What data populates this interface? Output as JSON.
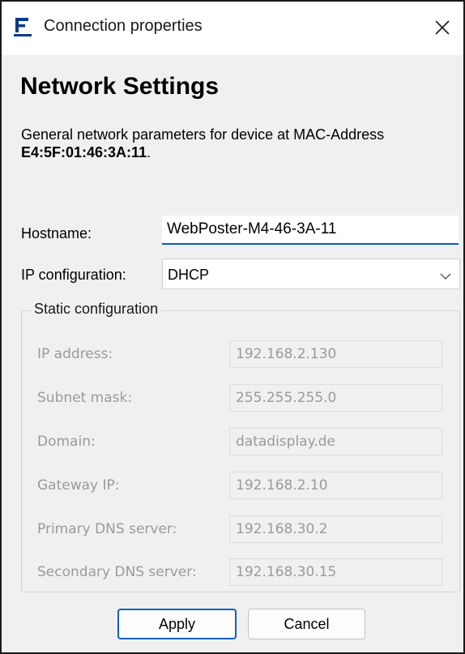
{
  "window": {
    "title": "Connection properties",
    "icon": "app-logo-f",
    "close_icon": "close-icon"
  },
  "heading": "Network Settings",
  "description": {
    "text": "General network parameters for device at MAC-Address",
    "mac": "E4:5F:01:46:3A:11",
    "suffix": "."
  },
  "hostname": {
    "label": "Hostname:",
    "value": "WebPoster-M4-46-3A-11"
  },
  "ip_configuration": {
    "label": "IP configuration:",
    "selected": "DHCP"
  },
  "static_configuration": {
    "title": "Static configuration",
    "fields": [
      {
        "label": "IP address:",
        "value": "192.168.2.130"
      },
      {
        "label": "Subnet mask:",
        "value": "255.255.255.0"
      },
      {
        "label": "Domain:",
        "value": "datadisplay.de"
      },
      {
        "label": "Gateway IP:",
        "value": "192.168.2.10"
      },
      {
        "label": "Primary DNS server:",
        "value": "192.168.30.2"
      },
      {
        "label": "Secondary DNS server:",
        "value": "192.168.30.15"
      }
    ]
  },
  "buttons": {
    "apply": "Apply",
    "cancel": "Cancel"
  },
  "colors": {
    "accent": "#0c59b8",
    "disabled_text": "#9a9a9a",
    "dialog_background": "#f0f0f0"
  }
}
